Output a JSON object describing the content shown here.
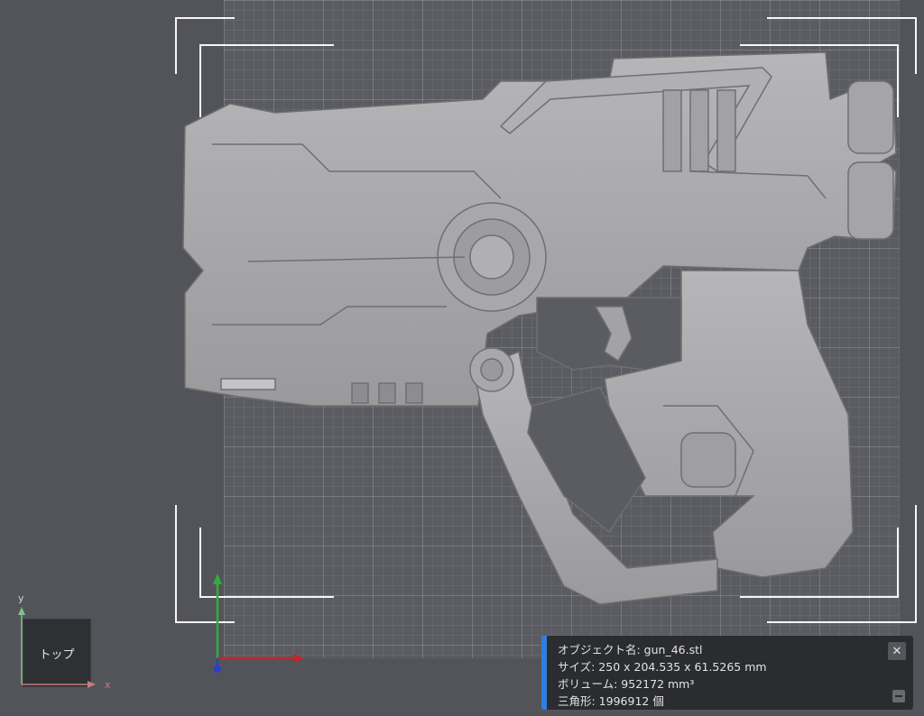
{
  "view": {
    "cube_label": "トップ",
    "axis_x": "x",
    "axis_y": "y"
  },
  "model_info": {
    "object_name": "オブジェクト名: gun_46.stl",
    "size": "サイズ: 250 x 204.535 x 61.5265 mm",
    "volume": "ボリューム: 952172 mm³",
    "triangles": "三角形: 1996912 個",
    "close_icon": "close-icon",
    "collapse_icon": "minus-icon"
  },
  "colors": {
    "background": "#535459",
    "bed": "#5b5c62",
    "model": "#a9a9ab",
    "accent": "#2f7fe0",
    "axis_x": "#c0262c",
    "axis_y": "#2fae3f",
    "axis_z": "#2b3fc8"
  }
}
